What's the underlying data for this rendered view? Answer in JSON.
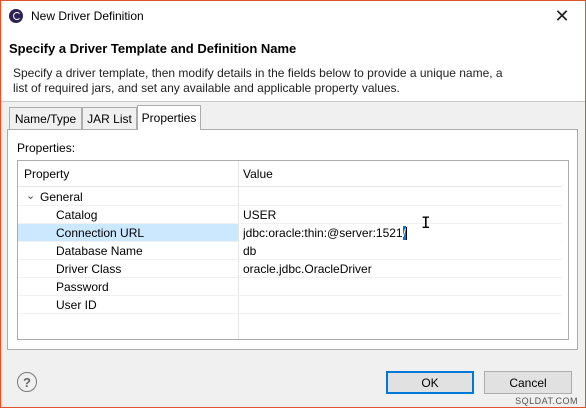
{
  "window": {
    "title": "New Driver Definition",
    "close_glyph": "✕"
  },
  "header": {
    "title": "Specify a Driver Template and Definition Name",
    "description": "Specify a driver template, then modify details in the fields below to provide a unique name, a list of required jars, and set any available and applicable property values."
  },
  "tabs": [
    {
      "label": "Name/Type",
      "active": false
    },
    {
      "label": "JAR List",
      "active": false
    },
    {
      "label": "Properties",
      "active": true
    }
  ],
  "properties_panel": {
    "label": "Properties:",
    "columns": {
      "property": "Property",
      "value": "Value"
    },
    "group": {
      "label": "General",
      "expanded": true
    },
    "rows": [
      {
        "property": "Catalog",
        "value": "USER"
      },
      {
        "property": "Connection URL",
        "value_prefix": "jdbc:oracle:thin:@server:1521",
        "value_selected": "/"
      },
      {
        "property": "Database Name",
        "value": "db"
      },
      {
        "property": "Driver Class",
        "value": "oracle.jdbc.OracleDriver"
      },
      {
        "property": "Password",
        "value": ""
      },
      {
        "property": "User ID",
        "value": ""
      }
    ]
  },
  "buttons": {
    "help": "?",
    "ok": "OK",
    "cancel": "Cancel"
  },
  "watermark": "SQLDAT.COM",
  "colors": {
    "border_accent": "#e0532b",
    "selection": "#0078d7",
    "row_highlight": "#cce8ff"
  }
}
